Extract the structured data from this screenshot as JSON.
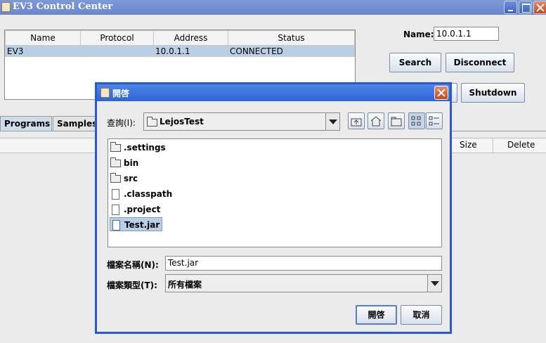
{
  "window": {
    "title": "EV3 Control Center"
  },
  "devices_table": {
    "columns": [
      "Name",
      "Protocol",
      "Address",
      "Status"
    ],
    "rows": [
      {
        "name": "EV3",
        "protocol": "",
        "address": "10.0.1.1",
        "status": "CONNECTED"
      }
    ]
  },
  "connection": {
    "name_label": "Name:",
    "name_value": "10.0.1.1",
    "search_label": "Search",
    "disconnect_label": "Disconnect",
    "shutdown_label": "Shutdown"
  },
  "tabs": [
    {
      "label": "Programs",
      "active": true
    },
    {
      "label": "Samples",
      "active": false
    }
  ],
  "programs_table": {
    "columns": [
      "Size",
      "Delete"
    ]
  },
  "open_dialog": {
    "title": "開啓",
    "look_in_label": "查詢(I):",
    "look_in_value": "LejosTest",
    "toolbar_icons": [
      "up-folder-icon",
      "home-icon",
      "new-folder-icon",
      "list-view-icon",
      "details-view-icon"
    ],
    "files": [
      {
        "name": ".settings",
        "type": "folder"
      },
      {
        "name": "bin",
        "type": "folder"
      },
      {
        "name": "src",
        "type": "folder"
      },
      {
        "name": ".classpath",
        "type": "file"
      },
      {
        "name": ".project",
        "type": "file"
      },
      {
        "name": "Test.jar",
        "type": "file",
        "selected": true
      }
    ],
    "file_name_label": "檔案名稱(N):",
    "file_name_value": "Test.jar",
    "file_type_label": "檔案類型(T):",
    "file_type_value": "所有檔案",
    "open_label": "開啓",
    "cancel_label": "取消"
  },
  "colors": {
    "title_bar": "#6a87cc",
    "dialog_title_bar": "#2f64d4",
    "selection": "#b8cfe5"
  }
}
